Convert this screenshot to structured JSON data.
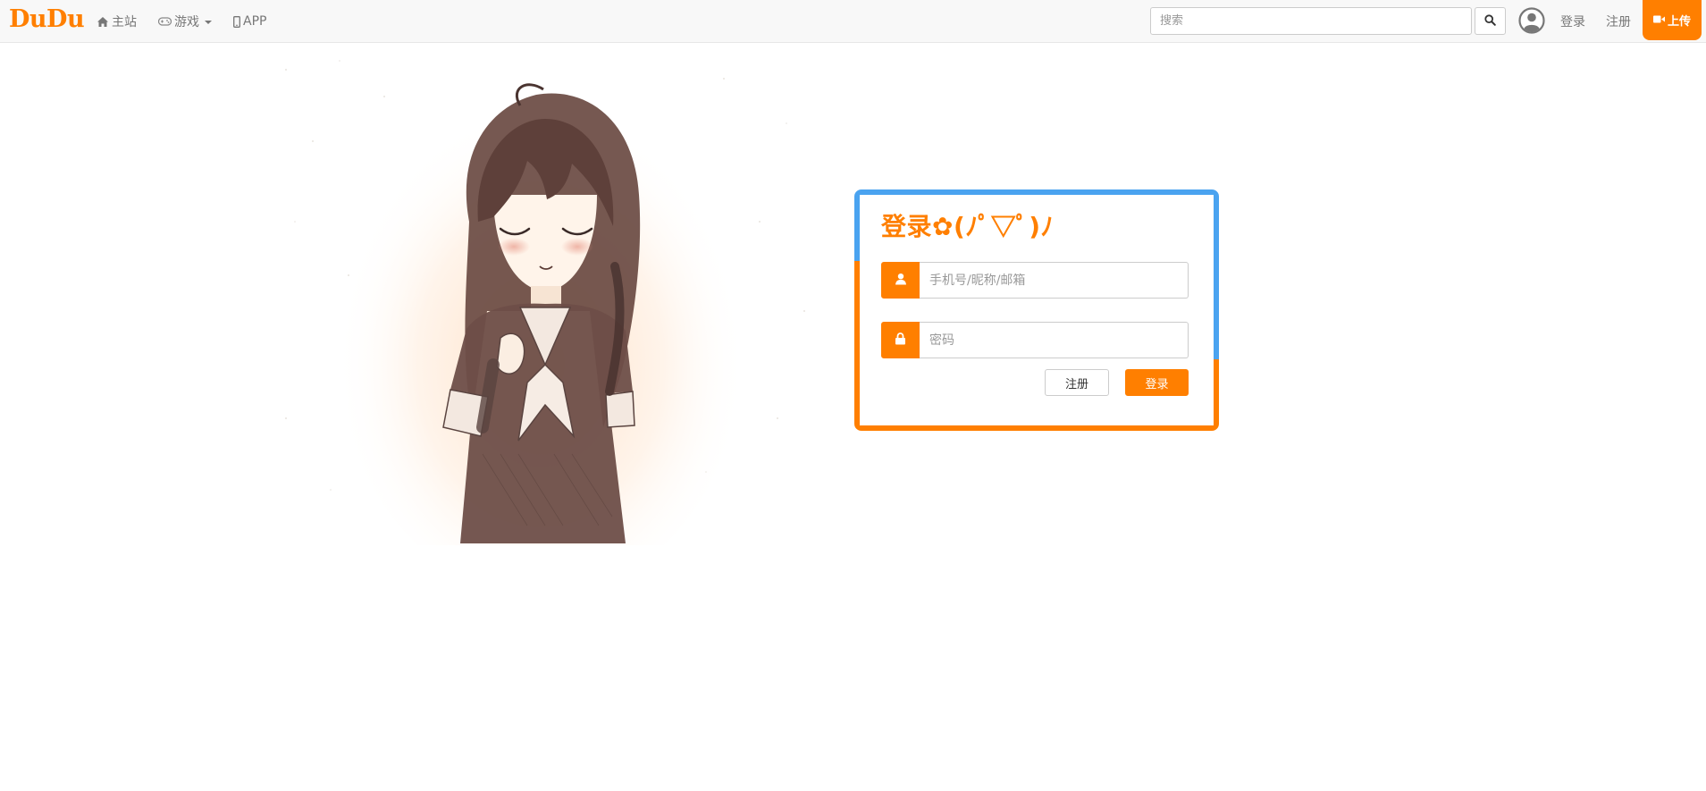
{
  "navbar": {
    "brand": "DuDu",
    "home_label": "主站",
    "game_label": "游戏",
    "app_label": "APP",
    "search_placeholder": "搜索",
    "login_label": "登录",
    "register_label": "注册",
    "upload_label": "上传"
  },
  "login": {
    "title": "登录✿(ﾉﾟ▽ﾟ)ﾉ",
    "username_placeholder": "手机号/昵称/邮箱",
    "password_placeholder": "密码",
    "register_button": "注册",
    "login_button": "登录"
  },
  "icons": {
    "home": "home-icon",
    "game": "gamepad-icon",
    "app": "mobile-phone-icon",
    "search": "search-icon",
    "avatar": "user-circle-icon",
    "upload": "video-camera-icon",
    "username": "user-icon",
    "password": "lock-icon"
  },
  "colors": {
    "accent": "#ff7f00",
    "frame_blue": "#4aa3f0",
    "navbar_bg": "#f8f8f8"
  }
}
